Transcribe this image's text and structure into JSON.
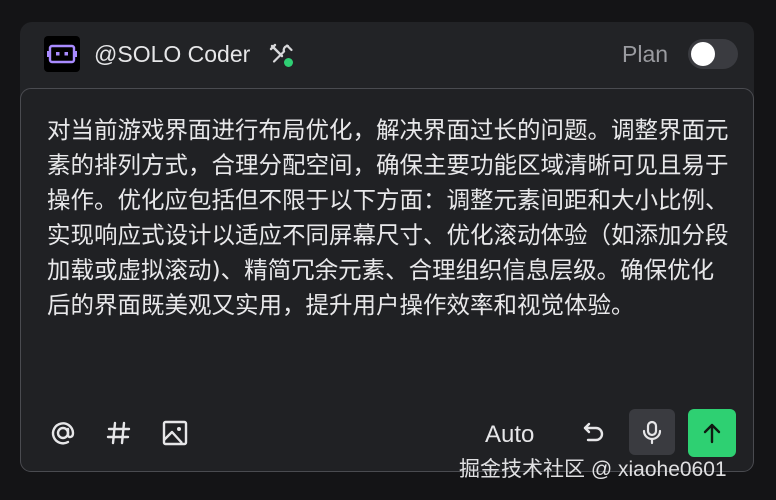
{
  "header": {
    "agent_name": "@SOLO Coder",
    "agent_icon": "robot-logo-icon",
    "tools_icon": "tools-icon",
    "status_color": "#2fcf74",
    "plan_label": "Plan",
    "plan_enabled": false
  },
  "prompt": {
    "text": "对当前游戏界面进行布局优化，解决界面过长的问题。调整界面元素的排列方式，合理分配空间，确保主要功能区域清晰可见且易于操作。优化应包括但不限于以下方面：调整元素间距和大小比例、实现响应式设计以适应不同屏幕尺寸、优化滚动体验（如添加分段加载或虚拟滚动)、精简冗余元素、合理组织信息层级。确保优化后的界面既美观又实用，提升用户操作效率和视觉体验。"
  },
  "toolbar": {
    "mention_icon": "at-icon",
    "hashtag_icon": "hash-icon",
    "image_icon": "image-icon",
    "mode_label": "Auto",
    "undo_icon": "undo-icon",
    "mic_icon": "microphone-icon",
    "send_icon": "arrow-up-icon",
    "send_color": "#2ed072"
  },
  "watermark": {
    "text": "掘金技术社区 @ xiaohe0601"
  }
}
